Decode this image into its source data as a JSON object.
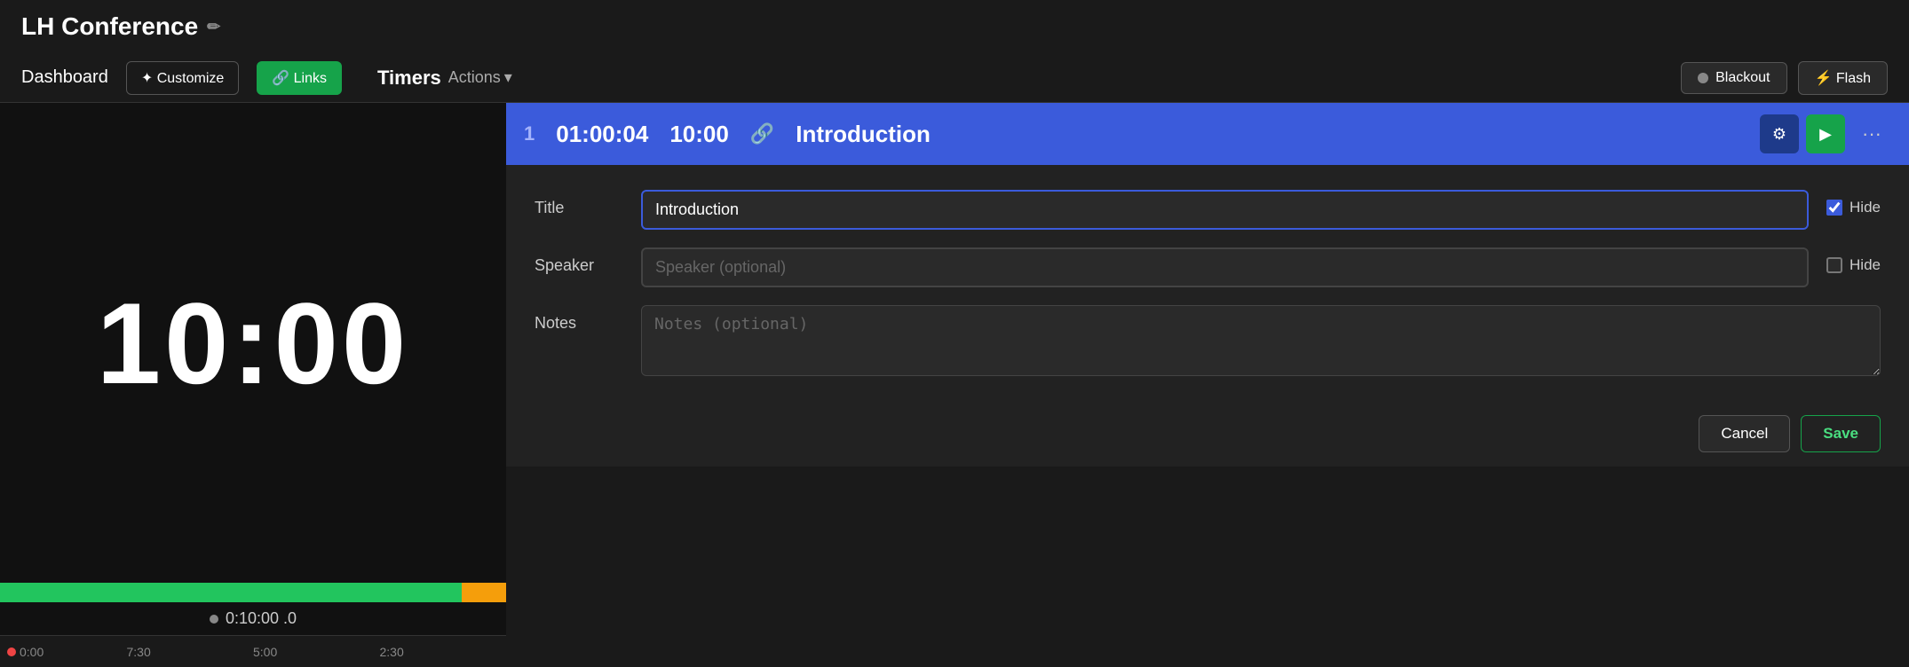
{
  "app": {
    "title": "LH Conference"
  },
  "nav": {
    "dashboard_label": "Dashboard",
    "customize_label": "✦ Customize",
    "links_label": "🔗 Links",
    "timers_label": "Timers",
    "actions_label": "Actions",
    "blackout_label": "Blackout",
    "flash_label": "⚡ Flash"
  },
  "timer_display": {
    "clock": "10:00",
    "time_remaining": "0:10:00 .0",
    "timeline_markers": [
      "0:00",
      "7:30",
      "5:00",
      "2:30"
    ]
  },
  "timer_row": {
    "number": "1",
    "elapsed": "01:00:04",
    "duration": "10:00",
    "title": "Introduction",
    "gear_label": "⚙",
    "play_label": "▶",
    "dots_label": "···"
  },
  "edit_form": {
    "title_label": "Title",
    "title_value": "Introduction",
    "title_placeholder": "",
    "speaker_label": "Speaker",
    "speaker_placeholder": "Speaker (optional)",
    "notes_label": "Notes",
    "notes_placeholder": "Notes (optional)",
    "hide_title_label": "Hide",
    "hide_title_checked": true,
    "hide_speaker_label": "Hide",
    "hide_speaker_checked": false
  },
  "actions": {
    "cancel_label": "Cancel",
    "save_label": "Save"
  }
}
